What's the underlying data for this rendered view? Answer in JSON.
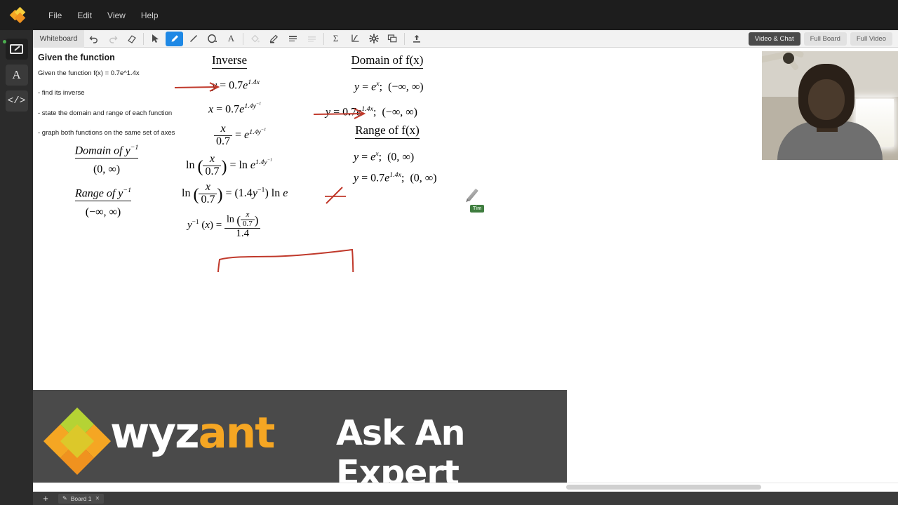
{
  "menubar": {
    "logo_icon": "wyzant-diamond-logo",
    "items": [
      {
        "label": "File"
      },
      {
        "label": "Edit"
      },
      {
        "label": "View"
      },
      {
        "label": "Help"
      }
    ]
  },
  "rail": {
    "items": [
      {
        "icon": "whiteboard-icon",
        "active": true
      },
      {
        "icon": "text-tool-icon",
        "label": "A"
      },
      {
        "icon": "code-tool-icon",
        "label": "</>"
      }
    ]
  },
  "toolbar": {
    "mode_label": "Whiteboard",
    "tools": [
      {
        "name": "undo-button",
        "icon": "undo-icon",
        "state": "enabled"
      },
      {
        "name": "redo-button",
        "icon": "redo-icon",
        "state": "disabled"
      },
      {
        "name": "eraser-button",
        "icon": "eraser-icon",
        "state": "enabled"
      },
      {
        "name": "select-button",
        "icon": "cursor-arrow-icon",
        "state": "enabled"
      },
      {
        "name": "pen-button",
        "icon": "pencil-icon",
        "state": "selected"
      },
      {
        "name": "line-button",
        "icon": "line-icon",
        "state": "enabled"
      },
      {
        "name": "shape-button",
        "icon": "ellipse-icon",
        "state": "enabled"
      },
      {
        "name": "text-button",
        "icon": "text-a-icon",
        "state": "enabled"
      },
      {
        "name": "fill-button",
        "icon": "paint-bucket-icon",
        "state": "disabled"
      },
      {
        "name": "highlighter-button",
        "icon": "highlighter-icon",
        "state": "enabled"
      },
      {
        "name": "line-width-button",
        "icon": "line-weight-icon",
        "state": "enabled"
      },
      {
        "name": "line-style-button",
        "icon": "line-style-icon",
        "state": "disabled"
      },
      {
        "name": "equation-button",
        "icon": "sigma-icon",
        "state": "enabled"
      },
      {
        "name": "graph-button",
        "icon": "graph-axis-icon",
        "state": "enabled"
      },
      {
        "name": "settings-button",
        "icon": "gear-icon",
        "state": "enabled"
      },
      {
        "name": "duplicate-button",
        "icon": "copy-layers-icon",
        "state": "enabled"
      },
      {
        "name": "upload-button",
        "icon": "upload-icon",
        "state": "enabled"
      }
    ],
    "view_buttons": [
      {
        "label": "Video & Chat",
        "active": true
      },
      {
        "label": "Full Board",
        "active": false
      },
      {
        "label": "Full Video",
        "active": false
      }
    ]
  },
  "canvas": {
    "problem": {
      "heading": "Given the function",
      "lines": [
        "Given the function f(x) = 0.7e^1.4x",
        "- find its inverse",
        "- state the domain and range of each function",
        "- graph both functions on the same set of axes"
      ]
    },
    "inverse_props": [
      {
        "title": "Domain of y",
        "title_sup": "−1",
        "value": "(0, ∞)"
      },
      {
        "title": "Range of y",
        "title_sup": "−1",
        "value": "(−∞, ∞)"
      }
    ],
    "inverse_column": {
      "heading": "Inverse",
      "steps": [
        "y = 0.7e^(1.4x)",
        "x = 0.7e^(1.4y^-1)",
        "x/0.7 = e^(1.4y^-1)",
        "ln(x/0.7) = ln e^(1.4y^-1)",
        "ln(x/0.7) = (1.4y^-1) ln e",
        "y^-1(x) = ln(x/0.7) / 1.4"
      ]
    },
    "domain_column": {
      "heading": "Domain of f(x)",
      "rows": [
        "y = e^x;  (−∞, ∞)",
        "y = 0.7e^(1.4x);  (−∞, ∞)"
      ]
    },
    "range_column": {
      "heading": "Range of f(x)",
      "rows": [
        "y = e^x;  (0, ∞)",
        "y = 0.7e^(1.4x);  (0, ∞)"
      ]
    },
    "annotations": {
      "ink_color": "#c0392b",
      "arrow_count": 2,
      "boxed_answer": true,
      "strikethrough": "ln e"
    },
    "remote_cursor": {
      "name": "Tim",
      "icon": "pencil-cursor-icon",
      "tag_color": "#3f7d3f"
    }
  },
  "video": {
    "label": "participant-webcam"
  },
  "banner": {
    "brand_first": "wyz",
    "brand_second": "ant",
    "tagline": "Ask An Expert",
    "brand_color": "#f5a623",
    "background": "#4a4a4a"
  },
  "bottombar": {
    "add_label": "+",
    "tabs": [
      {
        "label": "Board 1",
        "pen_icon": "pencil-icon",
        "close_icon": "close-icon"
      }
    ]
  }
}
